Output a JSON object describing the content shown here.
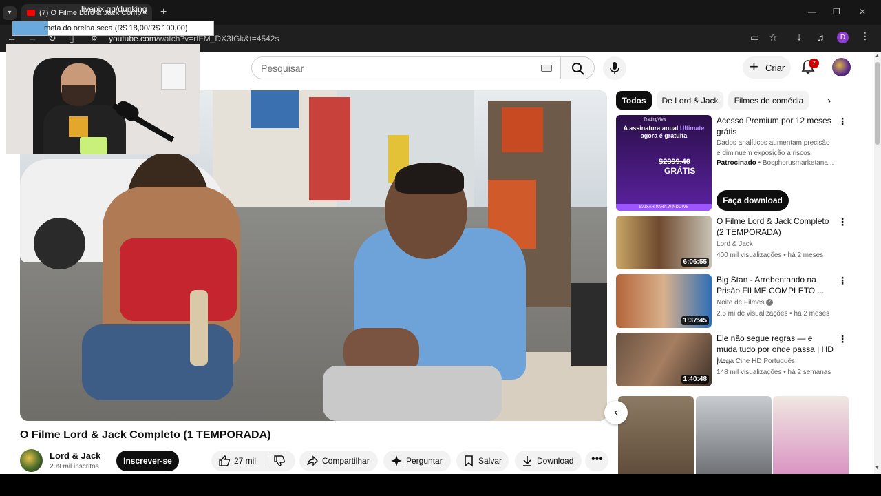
{
  "browser": {
    "tab_title": "(7) O Filme Lord & Jack Completo",
    "tab_overlay_text": "livepix.gg/dunking",
    "tooltip": "meta.do.orelha.seca (R$ 18,00/R$ 100,00)",
    "url_host": "youtube.com",
    "url_path": "/watch?v=rfFM_DX3IGk&t=4542s",
    "profile_initial": "D"
  },
  "header": {
    "search_placeholder": "Pesquisar",
    "create_label": "Criar",
    "notifications_count": "7"
  },
  "video": {
    "title": "O Filme Lord & Jack Completo (1 TEMPORADA)",
    "channel_name": "Lord & Jack",
    "channel_subs": "209 mil inscritos",
    "subscribe_label": "Inscrever-se",
    "likes": "27 mil",
    "share_label": "Compartilhar",
    "ask_label": "Perguntar",
    "save_label": "Salvar",
    "download_label": "Download",
    "more_label": "•••"
  },
  "chips": [
    "Todos",
    "De Lord & Jack",
    "Filmes de comédia"
  ],
  "ad": {
    "thumb_brand": "TradingView",
    "thumb_headline_1": "A assinatura anual",
    "thumb_headline_accent": "Ultimate",
    "thumb_headline_2": "agora é gratuita",
    "thumb_price": "$2399.40",
    "thumb_gratis": "GRÁTIS",
    "thumb_footer": "BAIXAR PARA WINDOWS",
    "title": "Acesso Premium por 12 meses grátis",
    "description": "Dados analíticos aumentam precisão e diminuem exposição a riscos",
    "sponsored": "Patrocinado",
    "advertiser": "Bosphorusmarketana...",
    "cta": "Faça download"
  },
  "recommendations": [
    {
      "title": "O Filme Lord & Jack Completo (2 TEMPORADA)",
      "channel": "Lord & Jack",
      "meta": "400 mil visualizações • há 2 meses",
      "duration": "6:06:55",
      "verified": false
    },
    {
      "title": "Big Stan - Arrebentando na Prisão FILME COMPLETO ...",
      "channel": "Noite de Filmes",
      "meta": "2,6 mi de visualizações • há 2 meses",
      "duration": "1:37:45",
      "verified": true
    },
    {
      "title": "Ele não segue regras — e muda tudo por onde passa | HD | ...",
      "channel": "Mega Cine HD Português",
      "meta": "148 mil visualizações • há 2 semanas",
      "duration": "1:40:48",
      "verified": false
    }
  ],
  "icons": {
    "menu": "⋮",
    "chip_next": "›",
    "shorts_prev": "‹"
  },
  "colors": {
    "brand_red": "#ff0000",
    "dark": "#0f0f0f",
    "chip_bg": "#f2f2f2"
  }
}
